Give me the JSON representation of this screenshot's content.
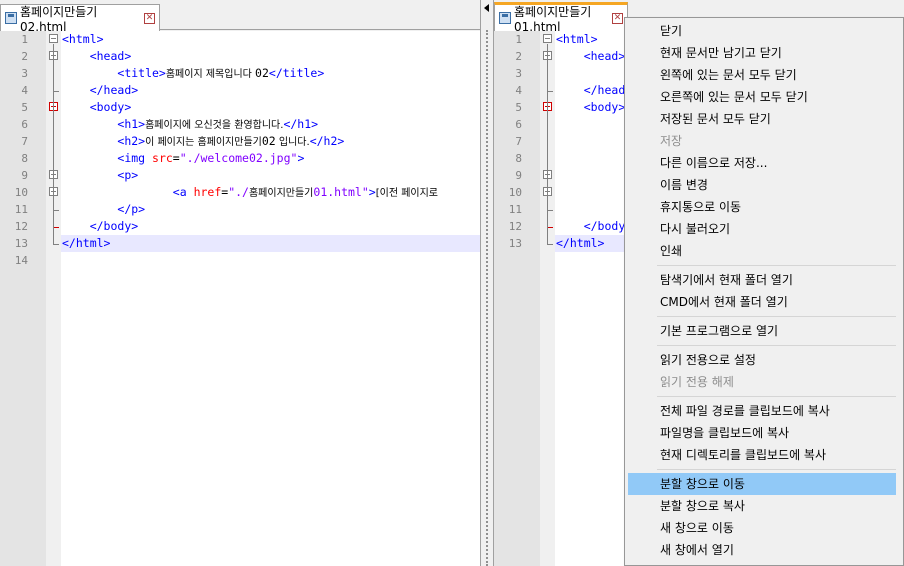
{
  "left_pane": {
    "tab_label": "홈페이지만들기02.html",
    "lines": [
      [
        [
          "tag",
          "<html>"
        ]
      ],
      [
        [
          "txt_sp",
          "    "
        ],
        [
          "tag",
          "<head>"
        ]
      ],
      [
        [
          "txt_sp",
          "        "
        ],
        [
          "tag",
          "<title>"
        ],
        [
          "txt",
          "홈페이지 제목입니다 "
        ],
        [
          "plain",
          "02"
        ],
        [
          "tag",
          "</title>"
        ]
      ],
      [
        [
          "txt_sp",
          "    "
        ],
        [
          "tag",
          "</head>"
        ]
      ],
      [
        [
          "txt_sp",
          "    "
        ],
        [
          "tag",
          "<body>"
        ]
      ],
      [
        [
          "txt_sp",
          "        "
        ],
        [
          "tag",
          "<h1>"
        ],
        [
          "txt",
          "홈페이지에 오신것을 환영합니다."
        ],
        [
          "tag",
          "</h1>"
        ]
      ],
      [
        [
          "txt_sp",
          "        "
        ],
        [
          "tag",
          "<h2>"
        ],
        [
          "txt",
          "이 페이지는 홈페이지만들기"
        ],
        [
          "plain",
          "02"
        ],
        [
          "txt",
          " 입니다."
        ],
        [
          "tag",
          "</h2>"
        ]
      ],
      [
        [
          "txt_sp",
          "        "
        ],
        [
          "tag",
          "<img "
        ],
        [
          "attr",
          "src"
        ],
        [
          "plain",
          "="
        ],
        [
          "str",
          "\"./welcome02.jpg\""
        ],
        [
          "tag",
          ">"
        ]
      ],
      [
        [
          "txt_sp",
          "        "
        ],
        [
          "tag",
          "<p>"
        ]
      ],
      [
        [
          "txt_sp",
          "                "
        ],
        [
          "tag",
          "<a "
        ],
        [
          "attr",
          "href"
        ],
        [
          "plain",
          "="
        ],
        [
          "str",
          "\"./"
        ],
        [
          "stxt",
          "홈페이지만들기"
        ],
        [
          "str",
          "01.html\""
        ],
        [
          "tag",
          ">"
        ],
        [
          "txt",
          "[이전 페이지로"
        ]
      ],
      [
        [
          "txt_sp",
          "        "
        ],
        [
          "tag",
          "</p>"
        ]
      ],
      [
        [
          "txt_sp",
          "    "
        ],
        [
          "tag",
          "</body>"
        ]
      ],
      [
        [
          "tag",
          "</html>"
        ]
      ],
      []
    ]
  },
  "right_pane": {
    "tab_label": "홈페이지만들기01.html",
    "lines": [
      [
        [
          "tag",
          "<html>"
        ]
      ],
      [
        [
          "txt_sp",
          "    "
        ],
        [
          "tag",
          "<head>"
        ]
      ],
      [],
      [
        [
          "txt_sp",
          "    "
        ],
        [
          "tag",
          "</head>"
        ]
      ],
      [
        [
          "txt_sp",
          "    "
        ],
        [
          "tag",
          "<body>"
        ]
      ],
      [],
      [],
      [],
      [],
      [],
      [],
      [
        [
          "txt_sp",
          "    "
        ],
        [
          "tag",
          "</body>"
        ]
      ],
      [
        [
          "tag",
          "</html>"
        ]
      ]
    ]
  },
  "line_numbers": [
    "1",
    "2",
    "3",
    "4",
    "5",
    "6",
    "7",
    "8",
    "9",
    "10",
    "11",
    "12",
    "13",
    "14"
  ],
  "context_menu": {
    "items": [
      {
        "label": "닫기",
        "disabled": false
      },
      {
        "label": "현재 문서만 남기고 닫기",
        "disabled": false
      },
      {
        "label": "왼쪽에 있는 문서 모두 닫기",
        "disabled": false
      },
      {
        "label": "오른쪽에 있는 문서 모두 닫기",
        "disabled": false
      },
      {
        "label": "저장된 문서 모두 닫기",
        "disabled": false
      },
      {
        "label": "저장",
        "disabled": true
      },
      {
        "label": "다른 이름으로 저장...",
        "disabled": false
      },
      {
        "label": "이름 변경",
        "disabled": false
      },
      {
        "label": "휴지통으로 이동",
        "disabled": false
      },
      {
        "label": "다시 불러오기",
        "disabled": false
      },
      {
        "label": "인쇄",
        "disabled": false
      },
      {
        "sep": true
      },
      {
        "label": "탐색기에서 현재 폴더 열기",
        "disabled": false
      },
      {
        "label": "CMD에서 현재 폴더 열기",
        "disabled": false
      },
      {
        "sep": true
      },
      {
        "label": "기본 프로그램으로 열기",
        "disabled": false
      },
      {
        "sep": true
      },
      {
        "label": "읽기 전용으로 설정",
        "disabled": false
      },
      {
        "label": "읽기 전용 해제",
        "disabled": true
      },
      {
        "sep": true
      },
      {
        "label": "전체 파일 경로를 클립보드에 복사",
        "disabled": false
      },
      {
        "label": "파일명을 클립보드에 복사",
        "disabled": false
      },
      {
        "label": "현재 디렉토리를 클립보드에 복사",
        "disabled": false
      },
      {
        "sep": true
      },
      {
        "label": "분할 창으로 이동",
        "disabled": false,
        "highlighted": true
      },
      {
        "label": "분할 창으로 복사",
        "disabled": false
      },
      {
        "label": "새 창으로 이동",
        "disabled": false
      },
      {
        "label": "새 창에서 열기",
        "disabled": false
      }
    ]
  },
  "colors": {
    "tag": "#0000ff",
    "attribute": "#ff0000",
    "string": "#8000ff",
    "current_line": "#e8e8ff",
    "menu_highlight": "#91c9f7",
    "active_tab_accent": "#f5a623"
  },
  "icons": [
    "save-disk-icon",
    "close-tab-icon",
    "fold-minus-icon",
    "splitter-arrow-icon"
  ]
}
